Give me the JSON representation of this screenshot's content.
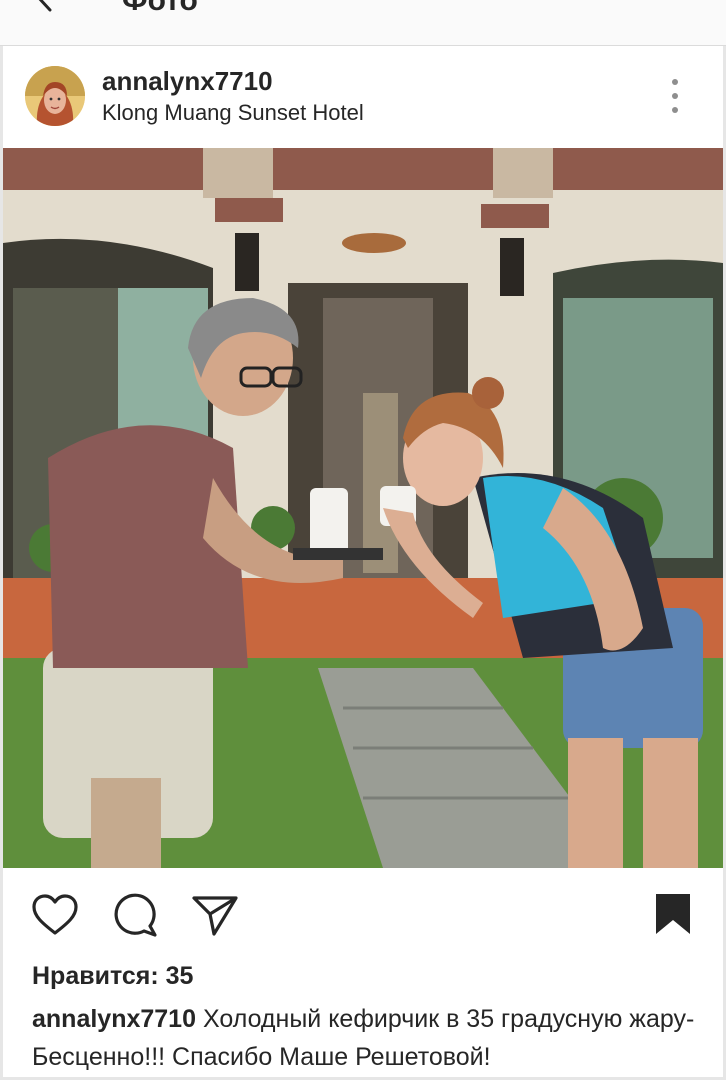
{
  "header": {
    "title": "Фото",
    "back_icon": "back-arrow-icon"
  },
  "post": {
    "username": "annalynx7710",
    "location": "Klong Muang Sunset Hotel",
    "more_icon": "more-vertical-icon"
  },
  "actions": {
    "icons": [
      "heart-icon",
      "comment-icon",
      "share-icon",
      "bookmark-icon"
    ]
  },
  "likes": {
    "label": "Нравится: 35"
  },
  "caption": {
    "username": "annalynx7710",
    "text": "Холодный кефирчик в 35 градусную жару- Бесценно!!! Спасибо Маше Решетовой!"
  },
  "colors": {
    "text": "#262626",
    "separator": "#dbdbdb"
  }
}
